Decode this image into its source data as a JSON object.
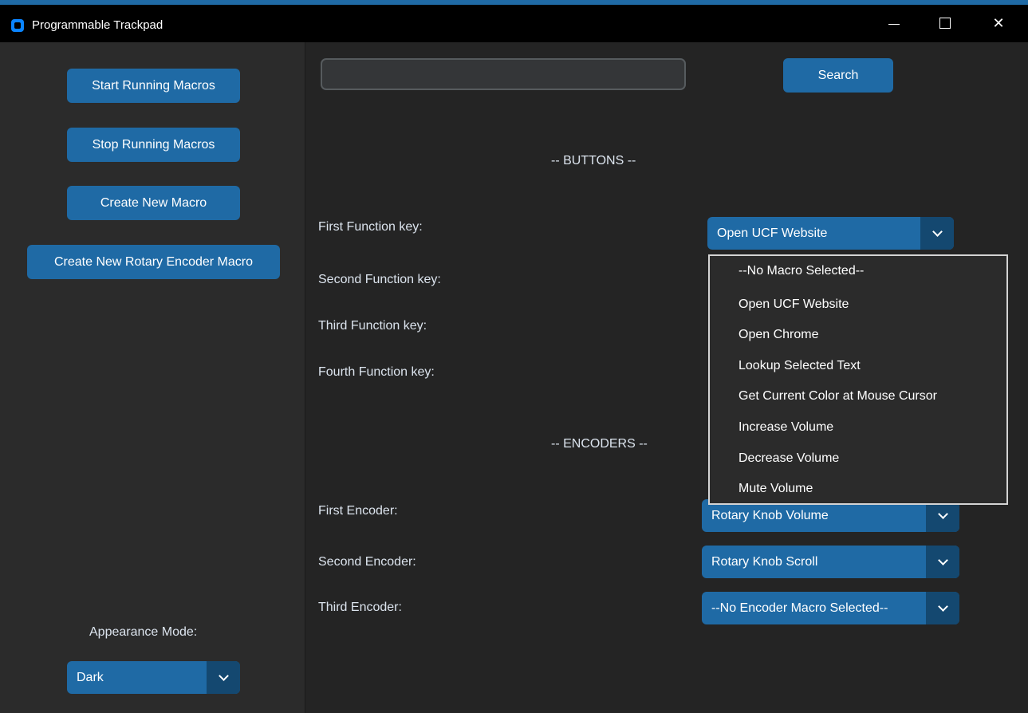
{
  "window": {
    "title": "Programmable Trackpad",
    "controls": {
      "minimize": "minimize-icon",
      "maximize": "maximize-icon",
      "close": "✕"
    }
  },
  "sidebar": {
    "buttons": [
      "Start Running Macros",
      "Stop Running Macros",
      "Create New Macro",
      "Create New Rotary Encoder Macro"
    ],
    "appearance_label": "Appearance Mode:",
    "appearance_value": "Dark"
  },
  "search": {
    "value": "",
    "button": "Search"
  },
  "buttons_section": {
    "header": "-- BUTTONS --",
    "labels": [
      "First Function key:",
      "Second Function key:",
      "Third Function key:",
      "Fourth Function key:"
    ],
    "first_value": "Open UCF Website"
  },
  "dropdown_options": [
    "--No Macro Selected--",
    "Open UCF Website",
    "Open Chrome",
    "Lookup Selected Text",
    "Get Current Color at Mouse Cursor",
    "Increase Volume",
    "Decrease Volume",
    "Mute Volume"
  ],
  "encoders_section": {
    "header": "-- ENCODERS --",
    "labels": [
      "First Encoder:",
      "Second Encoder:",
      "Third Encoder:"
    ],
    "values": [
      "Rotary Knob Volume",
      "Rotary Knob Scroll",
      "--No Encoder Macro Selected--"
    ]
  },
  "colors": {
    "accent": "#1f6aa5",
    "accent_dark": "#144870",
    "sidebar_bg": "#2b2b2b",
    "main_bg": "#242424"
  }
}
